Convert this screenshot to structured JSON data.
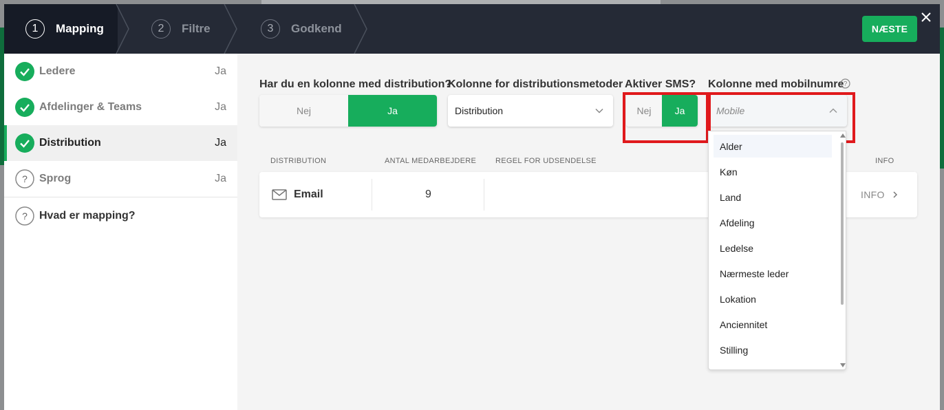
{
  "steps": [
    {
      "num": "1",
      "label": "Mapping"
    },
    {
      "num": "2",
      "label": "Filtre"
    },
    {
      "num": "3",
      "label": "Godkend"
    }
  ],
  "header": {
    "next_label": "NÆSTE"
  },
  "sidebar": {
    "items": [
      {
        "label": "Ledere",
        "value": "Ja",
        "status": "done"
      },
      {
        "label": "Afdelinger & Teams",
        "value": "Ja",
        "status": "done"
      },
      {
        "label": "Distribution",
        "value": "Ja",
        "status": "done"
      },
      {
        "label": "Sprog",
        "value": "Ja",
        "status": "unknown"
      }
    ],
    "help_label": "Hvad er mapping?"
  },
  "form": {
    "q1": {
      "label": "Har du en kolonne med distribution?",
      "no": "Nej",
      "yes": "Ja",
      "selected": "yes"
    },
    "q2": {
      "label": "Kolonne for distributionsmetoder",
      "value": "Distribution"
    },
    "q3": {
      "label": "Aktiver SMS?",
      "no": "Nej",
      "yes": "Ja",
      "selected": "yes"
    },
    "q4": {
      "label": "Kolonne med mobilnumre",
      "placeholder": "Mobile"
    }
  },
  "table": {
    "headers": {
      "distribution": "DISTRIBUTION",
      "count": "ANTAL MEDARBEJDERE",
      "rule": "REGEL FOR UDSENDELSE",
      "info": "INFO"
    },
    "rows": [
      {
        "method": "Email",
        "count": "9",
        "rule": "",
        "info": "INFO"
      }
    ]
  },
  "dropdown": {
    "options": [
      "Alder",
      "Køn",
      "Land",
      "Afdeling",
      "Ledelse",
      "Nærmeste leder",
      "Lokation",
      "Anciennitet",
      "Stilling"
    ]
  },
  "colors": {
    "accent": "#17ad5c",
    "header": "#252a36",
    "highlight": "#e0191c"
  }
}
